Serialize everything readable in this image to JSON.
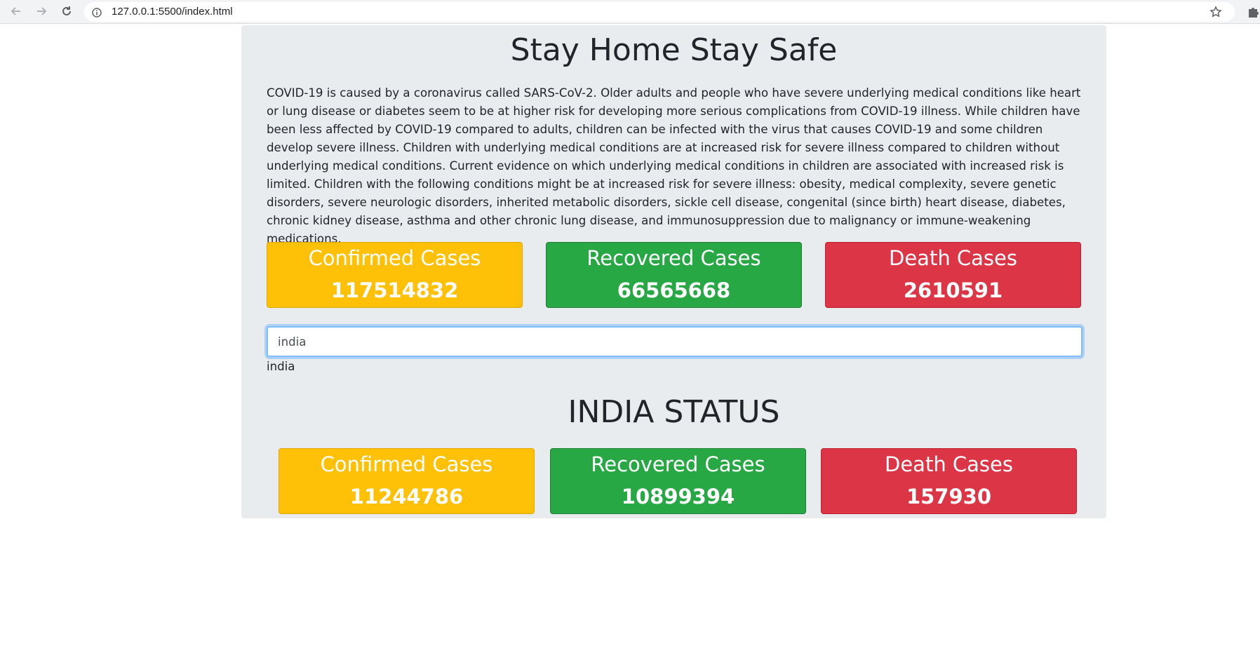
{
  "browser": {
    "url": "127.0.0.1:5500/index.html",
    "icons": [
      "back-arrow-icon",
      "forward-arrow-icon",
      "reload-icon",
      "info-icon",
      "star-icon",
      "extensions-icon"
    ]
  },
  "page": {
    "title": "Stay Home Stay Safe",
    "intro": "COVID-19 is caused by a coronavirus called SARS-CoV-2. Older adults and people who have severe underlying medical conditions like heart or lung disease or diabetes seem to be at higher risk for developing more serious complications from COVID-19 illness. While children have been less affected by COVID-19 compared to adults, children can be infected with the virus that causes COVID-19 and some children develop severe illness. Children with underlying medical conditions are at increased risk for severe illness compared to children without underlying medical conditions. Current evidence on which underlying medical conditions in children are associated with increased risk is limited. Children with the following conditions might be at increased risk for severe illness: obesity, medical complexity, severe genetic disorders, severe neurologic disorders, inherited metabolic disorders, sickle cell disease, congenital (since birth) heart disease, diabetes, chronic kidney disease, asthma and other chronic lung disease, and immunosuppression due to malignancy or immune-weakening medications."
  },
  "global": {
    "confirmed": {
      "label": "Confirmed Cases",
      "value": "117514832"
    },
    "recovered": {
      "label": "Recovered Cases",
      "value": "66565668"
    },
    "deaths": {
      "label": "Death Cases",
      "value": "2610591"
    }
  },
  "search": {
    "value": "india",
    "echo": "india"
  },
  "country": {
    "title": "INDIA STATUS",
    "confirmed": {
      "label": "Confirmed Cases",
      "value": "11244786"
    },
    "recovered": {
      "label": "Recovered Cases",
      "value": "10899394"
    },
    "deaths": {
      "label": "Death Cases",
      "value": "157930"
    }
  },
  "colors": {
    "confirmed": "#ffc107",
    "recovered": "#28a745",
    "deaths": "#dc3545",
    "container": "#e9ecef"
  }
}
